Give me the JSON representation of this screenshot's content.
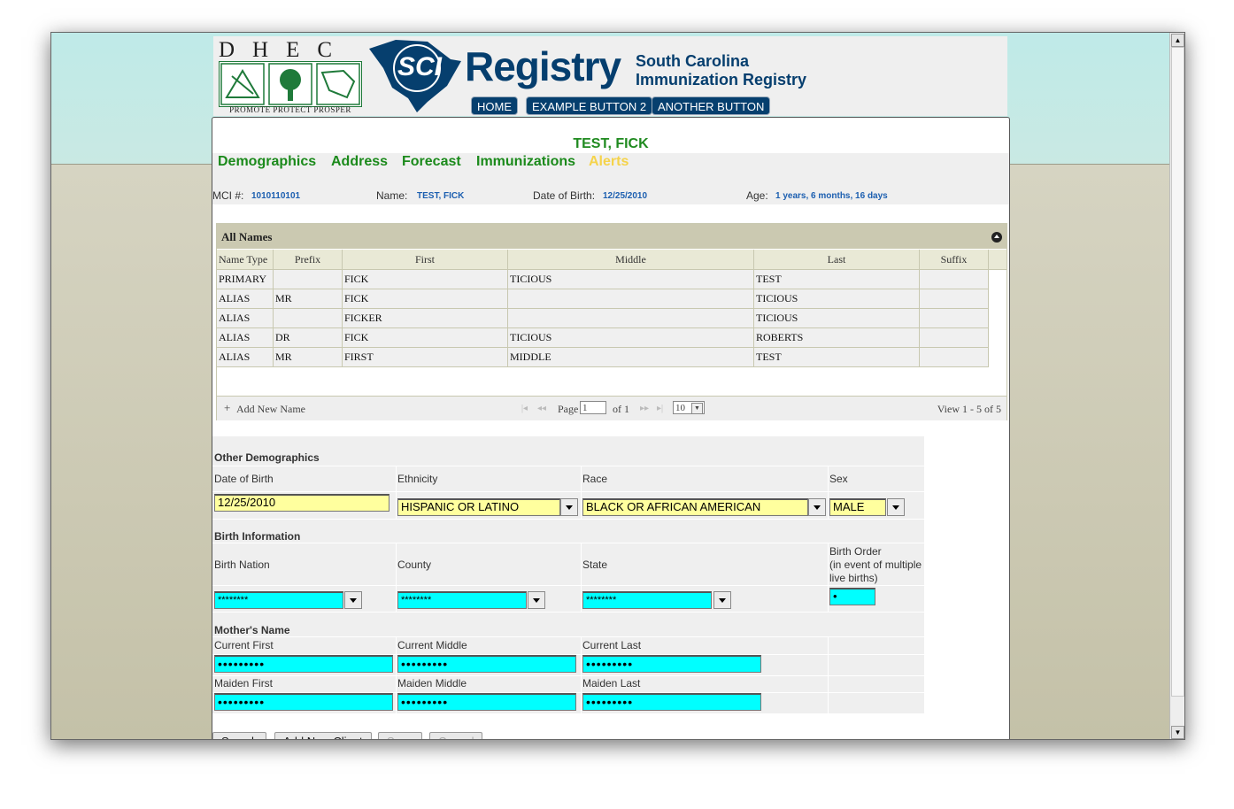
{
  "header": {
    "dhec_letters": "DHEC",
    "dhec_motto": "PROMOTE PROTECT PROSPER",
    "sci_logo_text": "SCI",
    "registry_word": "Registry",
    "registry_sub_line1": "South Carolina",
    "registry_sub_line2": "Immunization Registry",
    "nav_buttons": [
      "HOME",
      "EXAMPLE BUTTON 2",
      "ANOTHER BUTTON"
    ]
  },
  "patient": {
    "title": "TEST, FICK",
    "tabs": [
      "Demographics",
      "Address",
      "Forecast",
      "Immunizations",
      "Alerts"
    ],
    "mci_label": "MCI #:",
    "mci_value": "1010110101",
    "name_label": "Name:",
    "name_value": "TEST, FICK",
    "dob_label": "Date of Birth:",
    "dob_value": "12/25/2010",
    "age_label": "Age:",
    "age_value": "1 years, 6 months, 16 days"
  },
  "names_grid": {
    "title": "All Names",
    "columns": [
      "Name Type",
      "Prefix",
      "First",
      "Middle",
      "Last",
      "Suffix"
    ],
    "rows": [
      [
        "PRIMARY",
        "",
        "FICK",
        "TICIOUS",
        "TEST",
        ""
      ],
      [
        "ALIAS",
        "MR",
        "FICK",
        "",
        "TICIOUS",
        ""
      ],
      [
        "ALIAS",
        "",
        "FICKER",
        "",
        "TICIOUS",
        ""
      ],
      [
        "ALIAS",
        "DR",
        "FICK",
        "TICIOUS",
        "ROBERTS",
        ""
      ],
      [
        "ALIAS",
        "MR",
        "FIRST",
        "MIDDLE",
        "TEST",
        ""
      ]
    ],
    "pager": {
      "add_new": "Add New Name",
      "page_label": "Page",
      "page_value": "1",
      "of_label": "of 1",
      "page_size": "10",
      "view_text": "View 1 - 5 of 5"
    }
  },
  "other_demographics": {
    "section_title": "Other Demographics",
    "dob_label": "Date of Birth",
    "dob_value": "12/25/2010",
    "ethnicity_label": "Ethnicity",
    "ethnicity_value": "HISPANIC OR LATINO",
    "race_label": "Race",
    "race_value": "BLACK OR AFRICAN AMERICAN",
    "sex_label": "Sex",
    "sex_value": "MALE"
  },
  "birth_information": {
    "section_title": "Birth Information",
    "nation_label": "Birth Nation",
    "nation_value": "********",
    "county_label": "County",
    "county_value": "********",
    "state_label": "State",
    "state_value": "********",
    "order_label_1": "Birth Order",
    "order_label_2": "(in event of multiple",
    "order_label_3": "live births)",
    "order_value": "•"
  },
  "mothers_name": {
    "section_title": "Mother's Name",
    "current_first_label": "Current First",
    "current_middle_label": "Current Middle",
    "current_last_label": "Current Last",
    "maiden_first_label": "Maiden First",
    "maiden_middle_label": "Maiden Middle",
    "maiden_last_label": "Maiden Last",
    "masked_value": "•••••••••"
  },
  "bottom_buttons": [
    "Search",
    "Add New Client",
    "Save",
    "Cancel"
  ],
  "colors": {
    "navy": "#063f6e",
    "tab_green": "#1b8a1b",
    "alerts_yellow": "#f5d34a",
    "info_blue": "#1c5fb0",
    "required_yellow": "#ffff9e",
    "masked_cyan": "#00ffff"
  }
}
